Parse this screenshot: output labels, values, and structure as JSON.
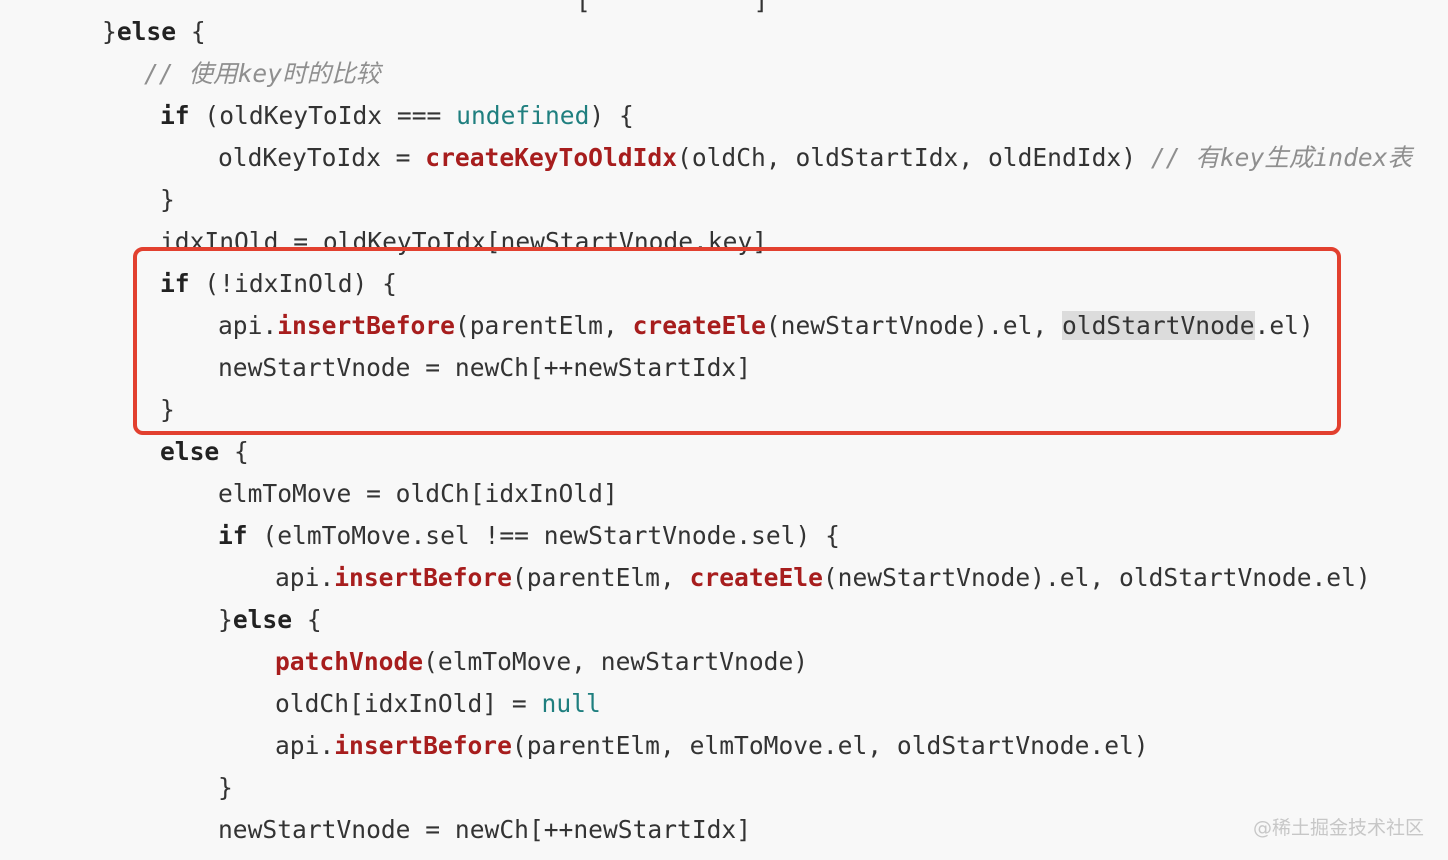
{
  "code": {
    "top_partial": "                                [           ]",
    "line_else_start": {
      "brace": "}",
      "else": "else",
      "rest": " {"
    },
    "comment_key_compare": "// 使用key时的比较",
    "line_if_undefined": {
      "if": "if",
      "mid": " (oldKeyToIdx === ",
      "undefined": "undefined",
      "end": ") {"
    },
    "line_assign_map": {
      "lhs": "oldKeyToIdx = ",
      "fn": "createKeyToOldIdx",
      "args": "(oldCh, oldStartIdx, oldEndIdx) ",
      "comment": "// 有key生成index表"
    },
    "close_1": "}",
    "line_idx_in_old": "idxInOld = oldKeyToIdx[newStartVnode.key]",
    "line_if_not_idx": {
      "if": "if",
      "rest": " (!idxInOld) {"
    },
    "line_insert_new": {
      "api": "api.",
      "fn1": "insertBefore",
      "mid1": "(parentElm, ",
      "fn2": "createEle",
      "mid2": "(newStartVnode).el, ",
      "hl": "oldStartVnode",
      "end": ".el)"
    },
    "line_advance_1": "newStartVnode = newCh[++newStartIdx]",
    "close_2": "}",
    "line_else": {
      "else": "else",
      "rest": " {"
    },
    "line_elm_to_move": "elmToMove = oldCh[idxInOld]",
    "line_if_sel": {
      "if": "if",
      "rest": " (elmToMove.sel !== newStartVnode.sel) {"
    },
    "line_insert_sel": {
      "api": "api.",
      "fn1": "insertBefore",
      "mid1": "(parentElm, ",
      "fn2": "createEle",
      "end": "(newStartVnode).el, oldStartVnode.el)"
    },
    "line_inner_else": {
      "brace": "}",
      "else": "else",
      "rest": " {"
    },
    "line_patch": {
      "fn": "patchVnode",
      "rest": "(elmToMove, newStartVnode)"
    },
    "line_null": {
      "lhs": "oldCh[idxInOld] = ",
      "lit": "null"
    },
    "line_insert_move": {
      "api": "api.",
      "fn": "insertBefore",
      "rest": "(parentElm, elmToMove.el, oldStartVnode.el)"
    },
    "close_3": "}",
    "line_advance_2": "newStartVnode = newCh[++newStartIdx]"
  },
  "watermark": "@稀土掘金技术社区",
  "colors": {
    "keyword": "#222222",
    "function": "#a71d1d",
    "literal": "#1f7f7f",
    "comment": "#8f8f8f",
    "highlight_box": "#e2402f",
    "background": "#f8f8f8"
  }
}
